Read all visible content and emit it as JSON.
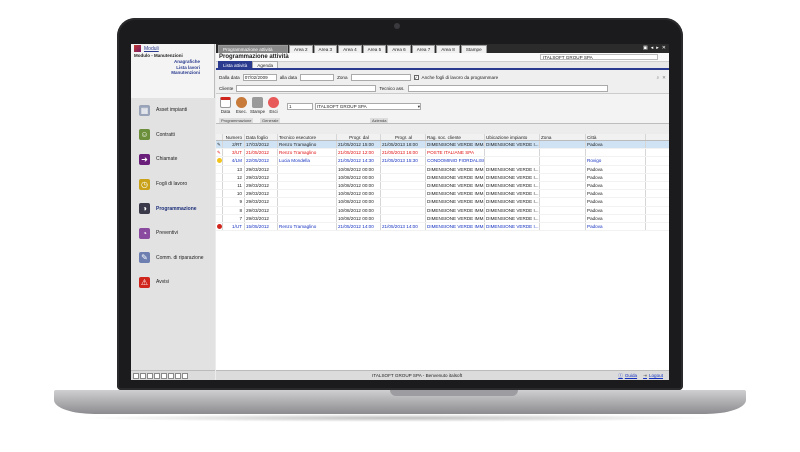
{
  "left": {
    "moduli_link": "Moduli",
    "module_title": "Modulo - Manutenzioni",
    "submenu": [
      "Anagrafiche",
      "Lista lavori",
      "Manutenzioni"
    ],
    "nav": [
      {
        "label": "Asset impianti",
        "icon": "asset-icon",
        "color": "#9aa4b8"
      },
      {
        "label": "Contratti",
        "icon": "contract-person-icon",
        "color": "#6b8f3a"
      },
      {
        "label": "Chiamate",
        "icon": "call-arrow-icon",
        "color": "#6a1f7a"
      },
      {
        "label": "Fogli di lavoro",
        "icon": "clock-icon",
        "color": "#c9a21a"
      },
      {
        "label": "Programmazione",
        "icon": "schedule-icon",
        "color": "#3a3a4a"
      },
      {
        "label": "Preventivi",
        "icon": "quote-icon",
        "color": "#8a4aa0"
      },
      {
        "label": "Comm. di riparazione",
        "icon": "repair-icon",
        "color": "#6c7fb0"
      },
      {
        "label": "Avvisi",
        "icon": "warning-icon",
        "color": "#d0251c"
      }
    ]
  },
  "tabs": [
    "Programmazione attività",
    "Area 2",
    "Area 3",
    "Area 4",
    "Area 5",
    "Area 6",
    "Area 7",
    "Area 8",
    "Stampe"
  ],
  "page_title": "Programmazione attività",
  "company": "ITALSOFT GROUP SPA",
  "subtabs": [
    "Lista attività",
    "Agenda"
  ],
  "filters": {
    "dalla_data_label": "Dalla data",
    "dalla_data_value": "07/02/2009",
    "alla_data_label": "alla data",
    "zona_label": "Zona",
    "check_label": "Anche fogli di lavoro da programmare",
    "cliente_label": "Cliente",
    "tecnico_label": "Tecnico ass."
  },
  "toolbar": {
    "buttons": [
      "Data",
      "Esec.",
      "Stampe",
      "Esci"
    ],
    "groups": [
      "Programmazione",
      "Generale",
      "Azienda"
    ],
    "azienda_num": "1",
    "azienda_name": "ITALSOFT GROUP SPA"
  },
  "grid": {
    "columns": [
      "Numero",
      "Data foglio",
      "Tecnico esecutore",
      "Progr. dal",
      "Progr. al",
      "Rag. soc. cliente",
      "Ubicazione impianto",
      "Zona",
      "Città"
    ],
    "rows": [
      {
        "n": "2/RT",
        "d": "17/03/2012",
        "t": "Renzo Tramaglino",
        "from": "21/05/2012 15:00",
        "to": "21/05/2013 18:00",
        "c": "DIMENSIONE VERDE IMM...",
        "u": "DIMENSIONE VERDE I...",
        "z": "",
        "city": "Padova",
        "color": "",
        "selected": true
      },
      {
        "n": "3/UT",
        "d": "21/05/2012",
        "t": "Renzo Tramaglino",
        "from": "21/05/2012 12:00",
        "to": "21/05/2013 16:00",
        "c": "POSTE ITALIANE SPA",
        "u": "",
        "z": "",
        "city": "",
        "color": "red",
        "selected": false
      },
      {
        "n": "4/LM",
        "d": "22/05/2012",
        "t": "Lucia Mondella",
        "from": "21/05/2012 14:30",
        "to": "21/05/2013 15:30",
        "c": "CONDOMINIO FIORDALISO",
        "u": "",
        "z": "",
        "city": "Rovigo",
        "color": "blue",
        "selected": false
      },
      {
        "n": "13",
        "d": "29/03/2012",
        "t": "",
        "from": "10/08/2012 00:00",
        "to": "",
        "c": "DIMENSIONE VERDE IMM...",
        "u": "DIMENSIONE VERDE I...",
        "z": "",
        "city": "Padova",
        "color": "",
        "selected": false
      },
      {
        "n": "12",
        "d": "29/03/2012",
        "t": "",
        "from": "10/08/2012 00:00",
        "to": "",
        "c": "DIMENSIONE VERDE IMM...",
        "u": "DIMENSIONE VERDE I...",
        "z": "",
        "city": "Padova",
        "color": "",
        "selected": false
      },
      {
        "n": "11",
        "d": "29/03/2012",
        "t": "",
        "from": "10/08/2012 00:00",
        "to": "",
        "c": "DIMENSIONE VERDE IMM...",
        "u": "DIMENSIONE VERDE I...",
        "z": "",
        "city": "Padova",
        "color": "",
        "selected": false
      },
      {
        "n": "10",
        "d": "29/03/2012",
        "t": "",
        "from": "10/08/2012 00:00",
        "to": "",
        "c": "DIMENSIONE VERDE IMM...",
        "u": "DIMENSIONE VERDE I...",
        "z": "",
        "city": "Padova",
        "color": "",
        "selected": false
      },
      {
        "n": "9",
        "d": "29/03/2012",
        "t": "",
        "from": "10/08/2012 00:00",
        "to": "",
        "c": "DIMENSIONE VERDE IMM...",
        "u": "DIMENSIONE VERDE I...",
        "z": "",
        "city": "Padova",
        "color": "",
        "selected": false
      },
      {
        "n": "8",
        "d": "29/03/2012",
        "t": "",
        "from": "10/08/2012 00:00",
        "to": "",
        "c": "DIMENSIONE VERDE IMM...",
        "u": "DIMENSIONE VERDE I...",
        "z": "",
        "city": "Padova",
        "color": "",
        "selected": false
      },
      {
        "n": "7",
        "d": "29/03/2012",
        "t": "",
        "from": "10/08/2012 00:00",
        "to": "",
        "c": "DIMENSIONE VERDE IMM...",
        "u": "DIMENSIONE VERDE I...",
        "z": "",
        "city": "Padova",
        "color": "",
        "selected": false
      },
      {
        "n": "1/UT",
        "d": "15/05/2012",
        "t": "Renzo Tramaglino",
        "from": "21/05/2012 14:00",
        "to": "21/05/2013 14:00",
        "c": "DIMENSIONE VERDE IMM...",
        "u": "DIMENSIONE VERDE I...",
        "z": "",
        "city": "Padova",
        "color": "blue",
        "selected": false
      }
    ]
  },
  "status": {
    "welcome": "ITALSOFT GROUP SPA - Benvenuto italsoft",
    "guida": "Guida",
    "logout": "Logout"
  }
}
